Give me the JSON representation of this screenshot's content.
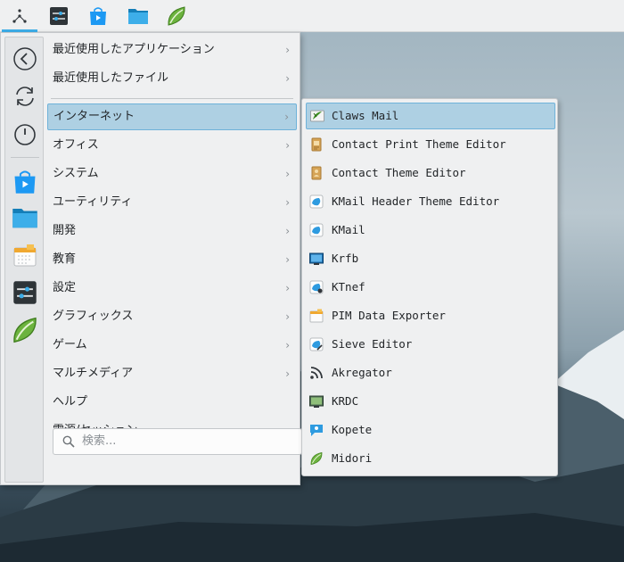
{
  "panel": {
    "tasks": [
      {
        "icon": "app-launcher-icon"
      },
      {
        "icon": "system-settings-icon"
      },
      {
        "icon": "discover-store-icon"
      },
      {
        "icon": "folder-icon"
      },
      {
        "icon": "midori-browser-icon"
      }
    ]
  },
  "favorites": [
    {
      "icon": "back-arrow-icon"
    },
    {
      "icon": "refresh-icon"
    },
    {
      "icon": "power-icon"
    },
    {
      "icon": "discover-store-icon"
    },
    {
      "icon": "folder-icon"
    },
    {
      "icon": "pim-data-icon"
    },
    {
      "icon": "system-settings-icon"
    },
    {
      "icon": "midori-browser-icon"
    }
  ],
  "categories": [
    {
      "label": "最近使用したアプリケーション",
      "submenu": true
    },
    {
      "label": "最近使用したファイル",
      "submenu": true
    },
    {
      "label": "インターネット",
      "submenu": true,
      "selected": true
    },
    {
      "label": "オフィス",
      "submenu": true
    },
    {
      "label": "システム",
      "submenu": true
    },
    {
      "label": "ユーティリティ",
      "submenu": true
    },
    {
      "label": "開発",
      "submenu": true
    },
    {
      "label": "教育",
      "submenu": true
    },
    {
      "label": "設定",
      "submenu": true
    },
    {
      "label": "グラフィックス",
      "submenu": true
    },
    {
      "label": "ゲーム",
      "submenu": true
    },
    {
      "label": "マルチメディア",
      "submenu": true
    },
    {
      "label": "ヘルプ",
      "submenu": false
    },
    {
      "label": "電源/セッション",
      "submenu": true
    }
  ],
  "arrow_glyph": "›",
  "search": {
    "placeholder": "検索..."
  },
  "apps": [
    {
      "label": "Claws Mail",
      "icon": "claws-mail-icon",
      "selected": true
    },
    {
      "label": "Contact Print Theme Editor",
      "icon": "contact-print-icon"
    },
    {
      "label": "Contact Theme Editor",
      "icon": "contact-theme-icon"
    },
    {
      "label": "KMail Header Theme Editor",
      "icon": "kmail-header-icon"
    },
    {
      "label": "KMail",
      "icon": "kmail-icon"
    },
    {
      "label": "Krfb",
      "icon": "krfb-icon"
    },
    {
      "label": "KTnef",
      "icon": "ktnef-icon"
    },
    {
      "label": "PIM Data Exporter",
      "icon": "pim-data-icon"
    },
    {
      "label": "Sieve Editor",
      "icon": "sieve-editor-icon"
    },
    {
      "label": "Akregator",
      "icon": "rss-feed-icon"
    },
    {
      "label": "KRDC",
      "icon": "krdc-icon"
    },
    {
      "label": "Kopete",
      "icon": "kopete-icon"
    },
    {
      "label": "Midori",
      "icon": "midori-browser-icon"
    }
  ],
  "colors": {
    "accent": "#3daee9",
    "selection": "#aed0e3",
    "menu_bg": "#eff0f1"
  }
}
